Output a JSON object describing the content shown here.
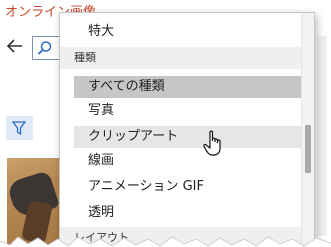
{
  "app": {
    "title_partial": "オンライン画像"
  },
  "dropdown": {
    "top_item": "特大",
    "section_type": "種類",
    "items": [
      {
        "label": "すべての種類",
        "state": "selected"
      },
      {
        "label": "写真",
        "state": "normal"
      },
      {
        "label": "クリップアート",
        "state": "hover"
      },
      {
        "label": "線画",
        "state": "normal"
      },
      {
        "label": "アニメーション GIF",
        "state": "normal"
      },
      {
        "label": "透明",
        "state": "normal"
      }
    ],
    "section_layout_partial": "レイアウト"
  },
  "colors": {
    "title_red": "#c8452c",
    "selected_bg": "#c6c6c6",
    "hover_bg": "#e6e6e6",
    "header_bg": "#efefef",
    "filter_bg": "#e1eaf7",
    "accent_blue": "#2b6cc4"
  },
  "icons": [
    "back-arrow-icon",
    "search-icon",
    "filter-icon",
    "hand-cursor-icon"
  ]
}
